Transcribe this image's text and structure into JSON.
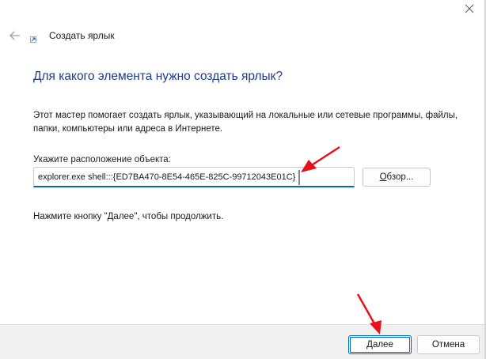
{
  "window": {
    "title": "Создать ярлык",
    "close_icon": "close-icon",
    "back_icon": "arrow-left-icon",
    "wizard_icon": "shortcut-wizard-icon"
  },
  "content": {
    "heading": "Для какого элемента нужно создать ярлык?",
    "description": "Этот мастер помогает создать ярлык, указывающий на локальные или сетевые программы, файлы, папки, компьютеры или адреса в Интернете.",
    "location_label": "Укажите расположение объекта:",
    "location_value": "explorer.exe shell:::{ED7BA470-8E54-465E-825C-99712043E01C}",
    "browse_label_underlined": "О",
    "browse_label_rest": "бзор...",
    "hint": "Нажмите кнопку \"Далее\", чтобы продолжить."
  },
  "footer": {
    "next_label_underlined": "Д",
    "next_label_rest": "алее",
    "cancel_label": "Отмена"
  },
  "colors": {
    "heading": "#1e3b8a",
    "accent": "#0067c0",
    "annotation_arrow": "#e8101a"
  }
}
